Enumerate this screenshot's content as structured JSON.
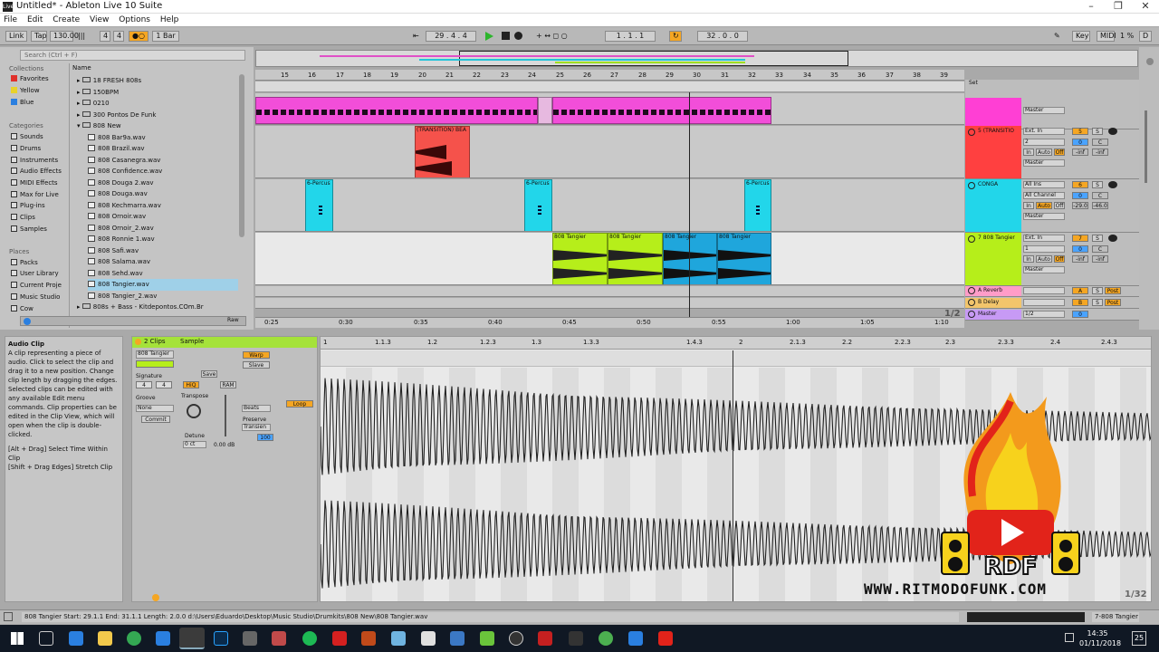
{
  "window": {
    "title": "Untitled* - Ableton Live 10 Suite",
    "logo": "Live"
  },
  "menu": [
    "File",
    "Edit",
    "Create",
    "View",
    "Options",
    "Help"
  ],
  "control": {
    "link": "Link",
    "tap": "Tap",
    "tempo": "130.00",
    "sig_num": "4",
    "sig_den": "4",
    "quant": "1 Bar",
    "position": "29 .   4 .   4",
    "loop_start": "1 .   1 .   1",
    "loop_len": "32 .   0 .   0",
    "key": "Key",
    "midi": "MIDI",
    "cpu": "1 %",
    "disk": "D"
  },
  "browser": {
    "search_placeholder": "Search (Ctrl + F)",
    "collections_header": "Collections",
    "collections": [
      {
        "label": "Favorites",
        "color": "#e0302a"
      },
      {
        "label": "Yellow",
        "color": "#e8d22b"
      },
      {
        "label": "Blue",
        "color": "#2a7fe0"
      }
    ],
    "categories_header": "Categories",
    "categories": [
      "Sounds",
      "Drums",
      "Instruments",
      "Audio Effects",
      "MIDI Effects",
      "Max for Live",
      "Plug-ins",
      "Clips",
      "Samples"
    ],
    "places_header": "Places",
    "places": [
      "Packs",
      "User Library",
      "Current Proje",
      "Music Studio",
      "Cow"
    ],
    "name_header": "Name",
    "files": [
      {
        "name": "18 FRESH 808s",
        "type": "folder"
      },
      {
        "name": "150BPM",
        "type": "folder"
      },
      {
        "name": "0210",
        "type": "folder"
      },
      {
        "name": "300 Pontos De Funk",
        "type": "folder"
      },
      {
        "name": "808 New",
        "type": "folder-open"
      },
      {
        "name": "808 Bar9a.wav",
        "type": "wav"
      },
      {
        "name": "808 Brazil.wav",
        "type": "wav"
      },
      {
        "name": "808 Casanegra.wav",
        "type": "wav"
      },
      {
        "name": "808 Confidence.wav",
        "type": "wav"
      },
      {
        "name": "808 Douga 2.wav",
        "type": "wav"
      },
      {
        "name": "808 Douga.wav",
        "type": "wav"
      },
      {
        "name": "808 Kechmarra.wav",
        "type": "wav"
      },
      {
        "name": "808 Ornoir.wav",
        "type": "wav"
      },
      {
        "name": "808 Ornoir_2.wav",
        "type": "wav"
      },
      {
        "name": "808 Ronnie 1.wav",
        "type": "wav"
      },
      {
        "name": "808 Safi.wav",
        "type": "wav"
      },
      {
        "name": "808 Salama.wav",
        "type": "wav"
      },
      {
        "name": "808 Sehd.wav",
        "type": "wav"
      },
      {
        "name": "808 Tangier.wav",
        "type": "wav",
        "selected": true
      },
      {
        "name": "808 Tangier_2.wav",
        "type": "wav"
      },
      {
        "name": "808s + Bass - Kitdepontos.COm.Br",
        "type": "folder"
      }
    ],
    "raw": "Raw"
  },
  "arrangement": {
    "bars": [
      "15",
      "16",
      "17",
      "18",
      "19",
      "20",
      "21",
      "22",
      "23",
      "24",
      "25",
      "26",
      "27",
      "28",
      "29",
      "30",
      "31",
      "32",
      "33",
      "34",
      "35",
      "36",
      "37",
      "38",
      "39"
    ],
    "times": [
      "0:25",
      "0:30",
      "0:35",
      "0:40",
      "0:45",
      "0:50",
      "0:55",
      "1:00",
      "1:05",
      "1:10"
    ],
    "zoom": "1/2",
    "clips": {
      "transition": "(TRANSITION) BEA",
      "percus1": "6-Percus",
      "percus2": "6-Percus",
      "percus3": "6-Percus",
      "tangier1": "808 Tangier",
      "tangier2": "808 Tangier",
      "tangier3": "808 Tangier",
      "tangier4": "808 Tangier"
    }
  },
  "mixer": {
    "set": "Set",
    "tracks": [
      {
        "name": "",
        "input": "Master",
        "color": "#ff3fd4",
        "num": ""
      },
      {
        "name": "5 (TRANSITIO",
        "input": "Ext. In",
        "chan": "2",
        "out": "Master",
        "color": "#ff4040",
        "num": "5",
        "vol": "0",
        "pan": "C",
        "inf1": "-inf",
        "inf2": "-inf"
      },
      {
        "name": "CONGA",
        "input": "All Ins",
        "chan": "All Channel",
        "out": "Master",
        "color": "#22d6ea",
        "num": "6",
        "vol": "0",
        "pan": "C",
        "inf1": "-29.0",
        "inf2": "-46.0"
      },
      {
        "name": "7 808 Tangier",
        "input": "Ext. In",
        "chan": "1",
        "out": "Master",
        "color": "#b6ee1a",
        "num": "7",
        "vol": "0",
        "pan": "C",
        "inf1": "-inf",
        "inf2": "-inf"
      }
    ],
    "returns": [
      {
        "name": "A Reverb",
        "num": "A",
        "color": "#ff9cc8",
        "post": "Post"
      },
      {
        "name": "B Delay",
        "num": "B",
        "color": "#f2c56b",
        "post": "Post"
      },
      {
        "name": "Master",
        "num": "1/2",
        "color": "#c79af5",
        "vol": "0"
      }
    ],
    "io_in": "In",
    "io_auto": "Auto",
    "io_off": "Off",
    "solo": "S"
  },
  "info": {
    "title": "Audio Clip",
    "body": "A clip representing a piece of audio. Click to select the clip and drag it to a new position. Change clip length by dragging the edges. Selected clips can be edited with any available Edit menu commands. Clip properties can be edited in the Clip View, which will open when the clip is double-clicked.",
    "hint1": "[Alt + Drag] Select Time Within Clip",
    "hint2": "[Shift + Drag Edges] Stretch Clip"
  },
  "clipview": {
    "clips": "2 Clips",
    "sample": "Sample",
    "name": "808 Tangier",
    "signature": "Signature",
    "sig_num": "4",
    "sig_den": "4",
    "groove": "Groove",
    "groove_val": "None",
    "commit": "Commit",
    "save": "Save",
    "hiq": "HiQ",
    "ram": "RAM",
    "transpose": "Transpose",
    "detune": "Detune",
    "detune_val": "0 ct",
    "gain_val": "0.00 dB",
    "warp": "Warp",
    "slave": "Slave",
    "loop": "Loop",
    "beats": "Beats",
    "preserve": "Preserve",
    "transients": "Transien",
    "flux": "100"
  },
  "sample": {
    "ticks": [
      "1",
      "1.1.3",
      "1.2",
      "1.2.3",
      "1.3",
      "1.3.3",
      "1.4.3",
      "2",
      "2.1.3",
      "2.2",
      "2.2.3",
      "2.3",
      "2.3.3",
      "2.4",
      "2.4.3"
    ],
    "zoom": "1/32"
  },
  "status": {
    "text": "808 Tangier  Start: 29.1.1  End: 31.1.1  Length: 2.0.0  d:\\Users\\Eduardo\\Desktop\\Music Studio\\Drumkits\\808 New\\808 Tangier.wav",
    "track": "7-808 Tangier"
  },
  "taskbar": {
    "time": "14:35",
    "date": "01/11/2018",
    "notif": "25"
  },
  "watermark": {
    "url": "WWW.RITMODOFUNK.COM",
    "logo": "RDF"
  }
}
